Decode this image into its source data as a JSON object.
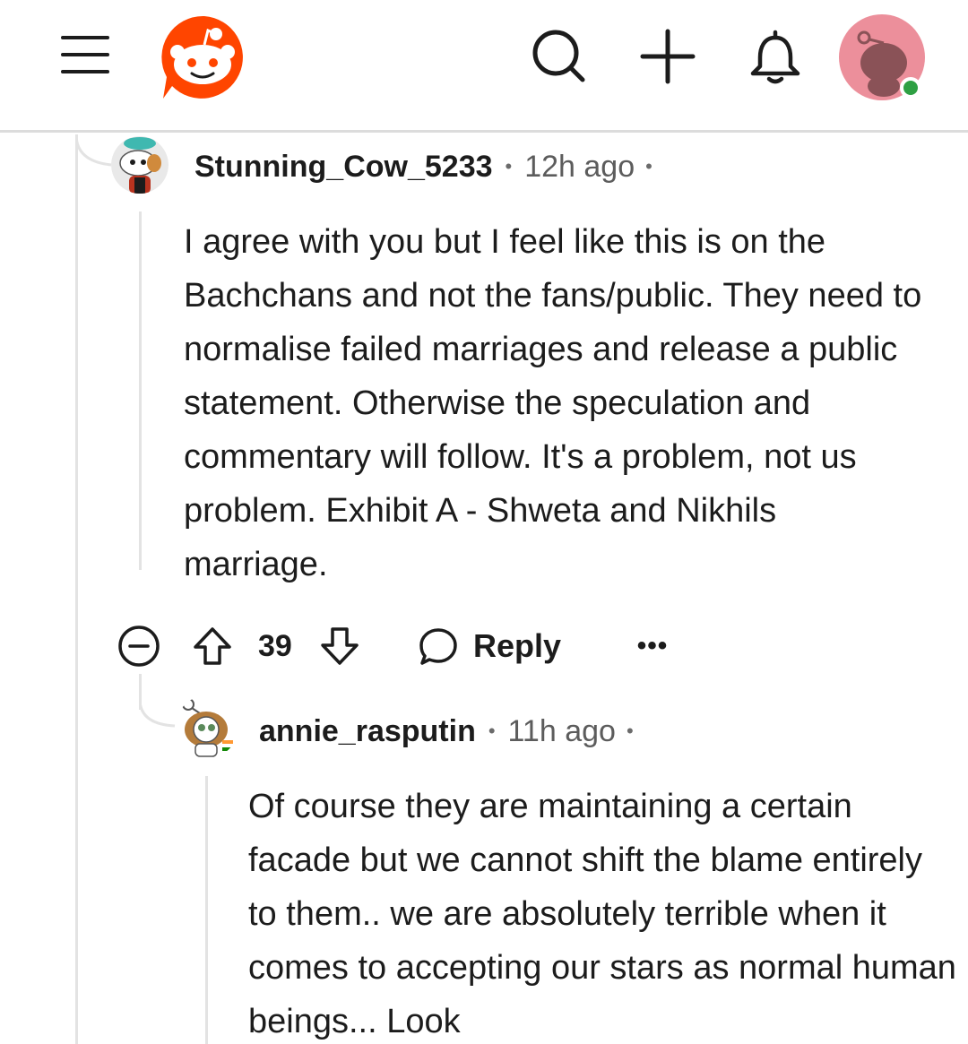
{
  "header": {
    "menu_icon": "hamburger-menu-icon",
    "logo_icon": "reddit-logo-icon",
    "search_icon": "search-icon",
    "create_icon": "plus-icon",
    "notifications_icon": "bell-icon",
    "avatar_icon": "user-avatar-icon",
    "online_status_color": "#2ea043",
    "brand_color": "#ff4500"
  },
  "comments": [
    {
      "username": "Stunning_Cow_5233",
      "separator": "•",
      "time_ago": "12h ago",
      "trailing_separator": "•",
      "body": "I agree with you but I feel like this is on the Bachchans and not the fans/public. They need to normalise failed marriages and release a public statement. Otherwise the speculation and commentary will follow. It's a problem, not us problem. Exhibit A - Shweta and Nikhils marriage.",
      "score": "39",
      "reply_label": "Reply",
      "more_label": "•••"
    },
    {
      "username": "annie_rasputin",
      "separator": "•",
      "time_ago": "11h ago",
      "trailing_separator": "•",
      "body": "Of course they are maintaining a certain facade but we cannot shift the blame entirely to them.. we are absolutely terrible when it comes to accepting our stars as normal human beings... Look"
    }
  ]
}
